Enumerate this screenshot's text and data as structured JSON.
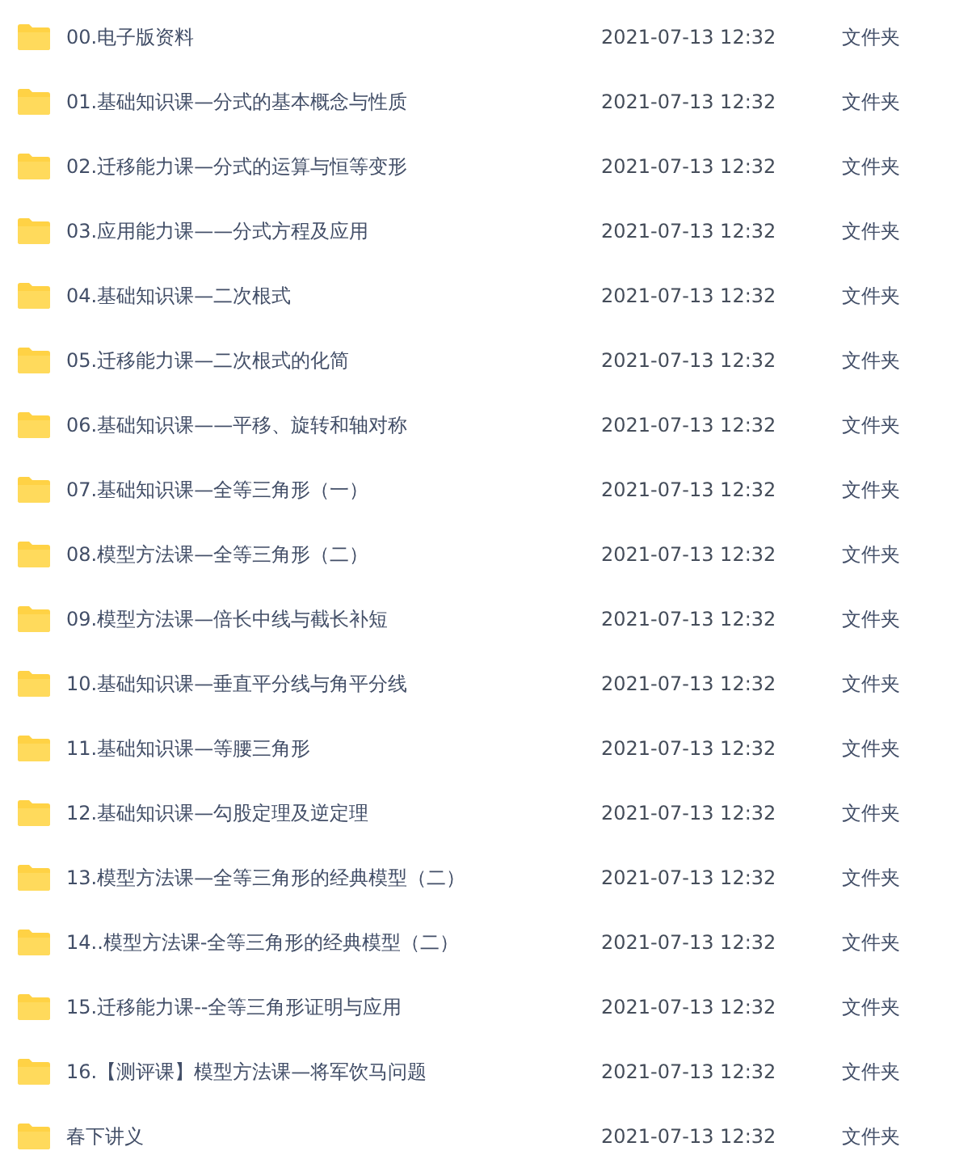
{
  "files": [
    {
      "name": "00.电子版资料",
      "modified": "2021-07-13 12:32",
      "type": "文件夹"
    },
    {
      "name": "01.基础知识课—分式的基本概念与性质",
      "modified": "2021-07-13 12:32",
      "type": "文件夹"
    },
    {
      "name": "02.迁移能力课—分式的运算与恒等变形",
      "modified": "2021-07-13 12:32",
      "type": "文件夹"
    },
    {
      "name": "03.应用能力课——分式方程及应用",
      "modified": "2021-07-13 12:32",
      "type": "文件夹"
    },
    {
      "name": "04.基础知识课—二次根式",
      "modified": "2021-07-13 12:32",
      "type": "文件夹"
    },
    {
      "name": "05.迁移能力课—二次根式的化简",
      "modified": "2021-07-13 12:32",
      "type": "文件夹"
    },
    {
      "name": "06.基础知识课——平移、旋转和轴对称",
      "modified": "2021-07-13 12:32",
      "type": "文件夹"
    },
    {
      "name": "07.基础知识课—全等三角形（一）",
      "modified": "2021-07-13 12:32",
      "type": "文件夹"
    },
    {
      "name": "08.模型方法课—全等三角形（二）",
      "modified": "2021-07-13 12:32",
      "type": "文件夹"
    },
    {
      "name": "09.模型方法课—倍长中线与截长补短",
      "modified": "2021-07-13 12:32",
      "type": "文件夹"
    },
    {
      "name": "10.基础知识课—垂直平分线与角平分线",
      "modified": "2021-07-13 12:32",
      "type": "文件夹"
    },
    {
      "name": "11.基础知识课—等腰三角形",
      "modified": "2021-07-13 12:32",
      "type": "文件夹"
    },
    {
      "name": "12.基础知识课—勾股定理及逆定理",
      "modified": "2021-07-13 12:32",
      "type": "文件夹"
    },
    {
      "name": "13.模型方法课—全等三角形的经典模型（二）",
      "modified": "2021-07-13 12:32",
      "type": "文件夹"
    },
    {
      "name": "14..模型方法课-全等三角形的经典模型（二）",
      "modified": "2021-07-13 12:32",
      "type": "文件夹"
    },
    {
      "name": "15.迁移能力课--全等三角形证明与应用",
      "modified": "2021-07-13 12:32",
      "type": "文件夹"
    },
    {
      "name": "16.【测评课】模型方法课—将军饮马问题",
      "modified": "2021-07-13 12:32",
      "type": "文件夹"
    },
    {
      "name": "春下讲义",
      "modified": "2021-07-13 12:32",
      "type": "文件夹"
    }
  ]
}
